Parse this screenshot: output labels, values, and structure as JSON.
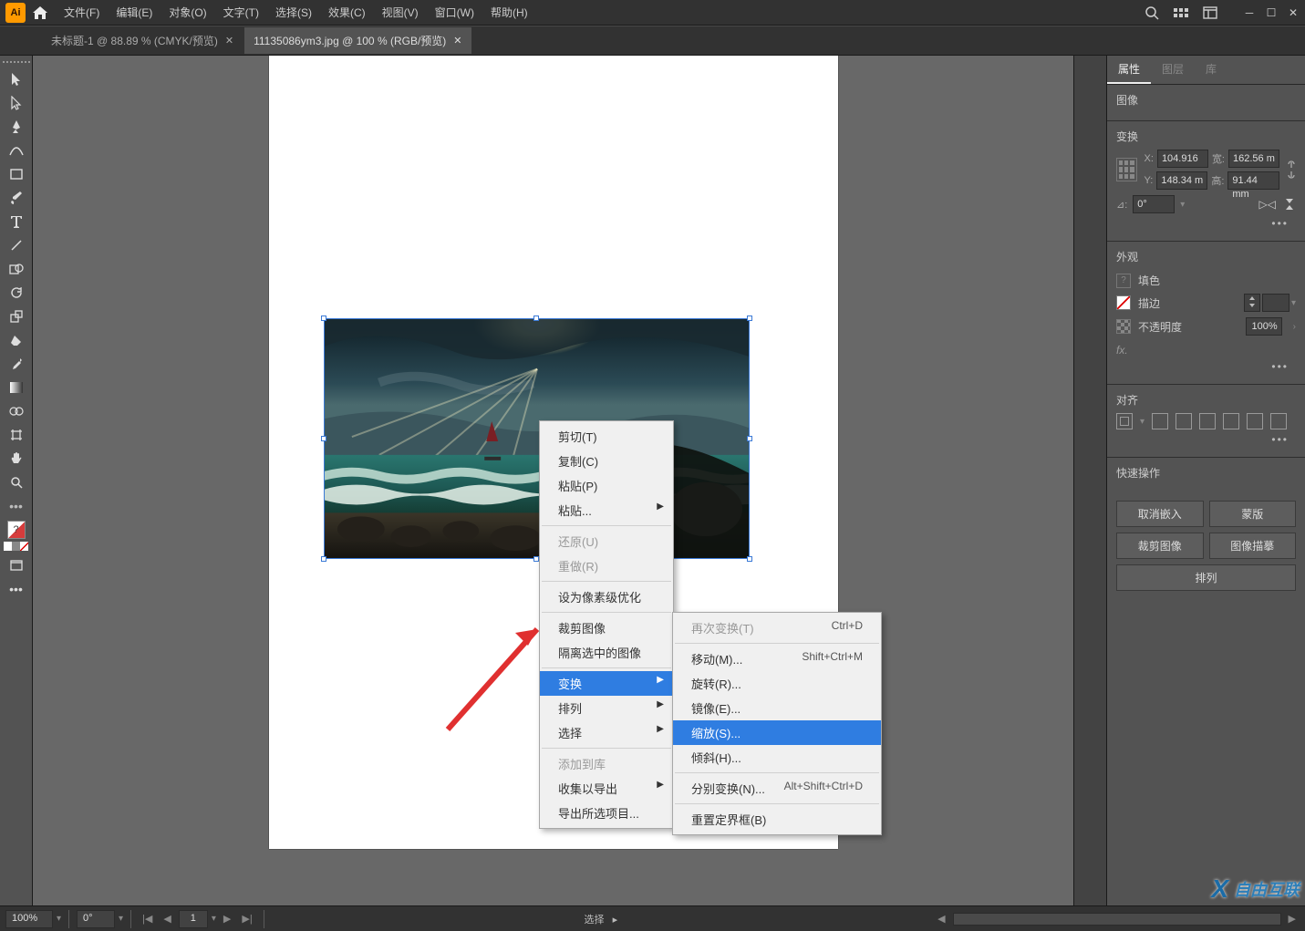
{
  "menu": {
    "items": [
      "文件(F)",
      "编辑(E)",
      "对象(O)",
      "文字(T)",
      "选择(S)",
      "效果(C)",
      "视图(V)",
      "窗口(W)",
      "帮助(H)"
    ]
  },
  "tabs": {
    "t1": "未标题-1 @ 88.89 % (CMYK/预览)",
    "t2": "11135086ym3.jpg @ 100 % (RGB/预览)"
  },
  "context1": {
    "cut": "剪切(T)",
    "copy": "复制(C)",
    "paste": "粘贴(P)",
    "paste_sub": "粘贴...",
    "undo": "还原(U)",
    "redo": "重做(R)",
    "pixel_opt": "设为像素级优化",
    "crop": "裁剪图像",
    "isolate": "隔离选中的图像",
    "transform": "变换",
    "arrange": "排列",
    "select": "选择",
    "add_lib": "添加到库",
    "collect_export": "收集以导出",
    "export_selection": "导出所选项目..."
  },
  "context2": {
    "retransform": "再次变换(T)",
    "retransform_sc": "Ctrl+D",
    "move": "移动(M)...",
    "move_sc": "Shift+Ctrl+M",
    "rotate": "旋转(R)...",
    "reflect": "镜像(E)...",
    "scale": "缩放(S)...",
    "shear": "倾斜(H)...",
    "each": "分别变换(N)...",
    "each_sc": "Alt+Shift+Ctrl+D",
    "reset_bbox": "重置定界框(B)"
  },
  "panel": {
    "tabs": {
      "properties": "属性",
      "layers": "图层",
      "library": "库"
    },
    "image_label": "图像",
    "transform_title": "变换",
    "x": "104.916",
    "y": "148.34 m",
    "w": "162.56 m",
    "h": "91.44 mm",
    "x_label": "X:",
    "y_label": "Y:",
    "w_label": "宽:",
    "h_label": "高:",
    "angle_label": "⊿:",
    "angle": "0°",
    "appearance_title": "外观",
    "fill": "填色",
    "stroke": "描边",
    "opacity": "不透明度",
    "opacity_val": "100%",
    "align_title": "对齐",
    "quick_title": "快速操作",
    "btn_unembed": "取消嵌入",
    "btn_mask": "蒙版",
    "btn_crop": "裁剪图像",
    "btn_trace": "图像描摹",
    "btn_arrange": "排列",
    "fx": "fx."
  },
  "status": {
    "zoom": "100%",
    "rotate": "0°",
    "page": "1",
    "mode": "选择"
  },
  "watermark": "自由互联"
}
